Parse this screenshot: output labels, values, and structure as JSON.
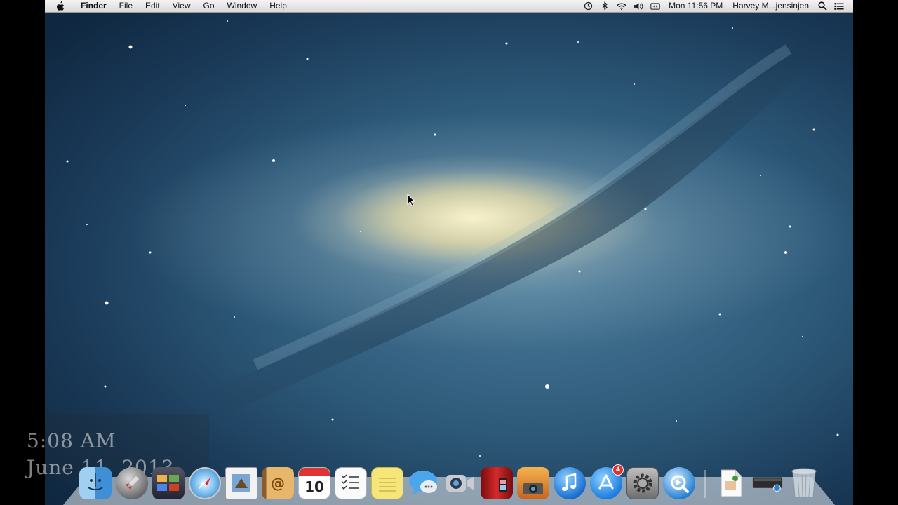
{
  "menubar": {
    "app_name": "Finder",
    "menus": [
      "File",
      "Edit",
      "View",
      "Go",
      "Window",
      "Help"
    ],
    "clock": "Mon 11:56 PM",
    "user": "Harvey M...jensinjen"
  },
  "overlay": {
    "time": "5:08 AM",
    "date": "June 11, 2013"
  },
  "dock": {
    "calendar_day": "10",
    "app_store_badge": "4",
    "apps": [
      "finder",
      "launchpad",
      "mission-control",
      "safari",
      "mail",
      "contacts",
      "calendar",
      "reminders",
      "notes",
      "messages",
      "facetime",
      "photo-booth",
      "iphoto",
      "itunes",
      "app-store",
      "system-preferences",
      "quicktime"
    ],
    "stacks": [
      "document",
      "hard-drive",
      "trash"
    ]
  },
  "colors": {
    "menubar": "#e6e6e6",
    "desktop_deep": "#0f2740",
    "galaxy_core": "#fff6cd"
  }
}
